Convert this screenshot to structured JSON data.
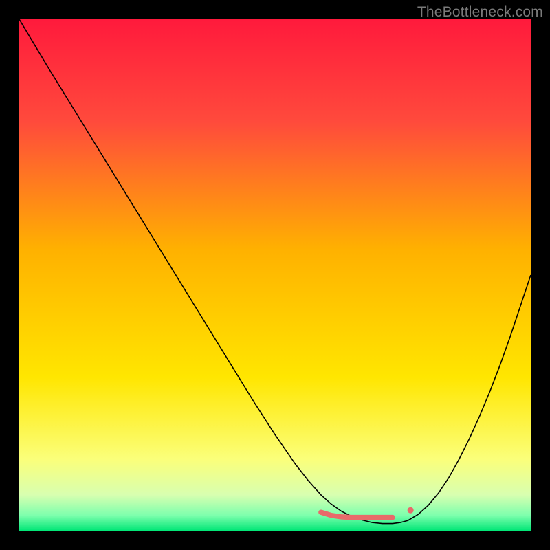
{
  "watermark": "TheBottleneck.com",
  "chart_data": {
    "type": "line",
    "title": "",
    "xlabel": "",
    "ylabel": "",
    "xlim": [
      0,
      100
    ],
    "ylim": [
      0,
      100
    ],
    "background_gradient": {
      "stops": [
        {
          "offset": 0.0,
          "color": "#ff1a3c"
        },
        {
          "offset": 0.2,
          "color": "#ff4a3c"
        },
        {
          "offset": 0.45,
          "color": "#ffb100"
        },
        {
          "offset": 0.7,
          "color": "#ffe600"
        },
        {
          "offset": 0.86,
          "color": "#fbff7a"
        },
        {
          "offset": 0.93,
          "color": "#d8ffb0"
        },
        {
          "offset": 0.97,
          "color": "#7dffad"
        },
        {
          "offset": 1.0,
          "color": "#00e676"
        }
      ]
    },
    "series": [
      {
        "name": "bottleneck-curve",
        "stroke": "#000000",
        "stroke_width": 1.6,
        "fill": "none",
        "x": [
          0.0,
          3.0,
          6.0,
          10.0,
          14.0,
          18.0,
          22.0,
          26.0,
          30.0,
          34.0,
          38.0,
          42.0,
          46.0,
          50.0,
          54.0,
          56.5,
          59.0,
          61.0,
          63.0,
          65.0,
          67.0,
          69.0,
          71.0,
          73.0,
          74.5,
          76.0,
          78.0,
          80.0,
          82.0,
          84.0,
          86.0,
          88.0,
          90.0,
          92.0,
          94.0,
          96.0,
          98.0,
          100.0
        ],
        "y": [
          100.0,
          95.0,
          90.0,
          83.5,
          77.0,
          70.5,
          64.0,
          57.5,
          51.0,
          44.5,
          38.0,
          31.5,
          25.0,
          18.8,
          13.0,
          9.8,
          7.0,
          5.2,
          3.8,
          2.8,
          2.1,
          1.6,
          1.4,
          1.4,
          1.6,
          2.0,
          3.2,
          5.0,
          7.4,
          10.4,
          14.0,
          18.0,
          22.4,
          27.2,
          32.4,
          38.0,
          44.0,
          50.0
        ]
      },
      {
        "name": "optimal-zone-marker",
        "stroke": "#e86a6a",
        "stroke_width": 7.5,
        "linecap": "round",
        "fill": "none",
        "x": [
          59.0,
          61.0,
          63.0,
          65.0,
          67.0,
          69.0,
          71.0,
          73.0
        ],
        "y": [
          3.6,
          3.0,
          2.7,
          2.6,
          2.6,
          2.6,
          2.6,
          2.6
        ]
      }
    ],
    "markers": [
      {
        "name": "optimal-dot",
        "x": 76.5,
        "y": 4.0,
        "r": 4.5,
        "fill": "#e86a6a"
      }
    ]
  }
}
